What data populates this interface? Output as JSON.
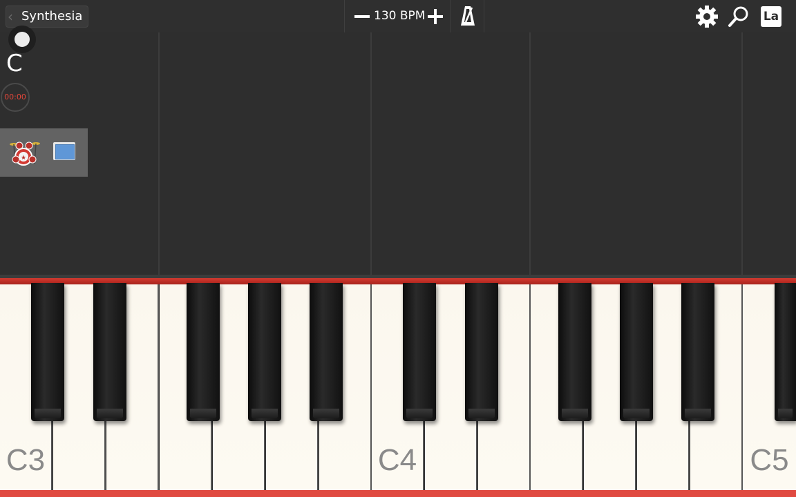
{
  "app": {
    "back_label": "Synthesia"
  },
  "tempo": {
    "bpm_text": "130 BPM"
  },
  "toolbar": {
    "labels_button_text": "La"
  },
  "left_panel": {
    "key_signature": "C",
    "timer": "00:00"
  },
  "keyboard": {
    "octave_labels": {
      "c3": "C3",
      "c4": "C4",
      "c5": "C5"
    }
  },
  "colors": {
    "accent_red": "#d43a30",
    "timer_red": "#e0463a",
    "background": "#2e2e2e"
  },
  "icons": [
    "chevron-left-icon",
    "minus-icon",
    "plus-icon",
    "metronome-icon",
    "gear-icon",
    "search-icon",
    "record-icon",
    "drum-kit-icon",
    "screen-icon"
  ]
}
